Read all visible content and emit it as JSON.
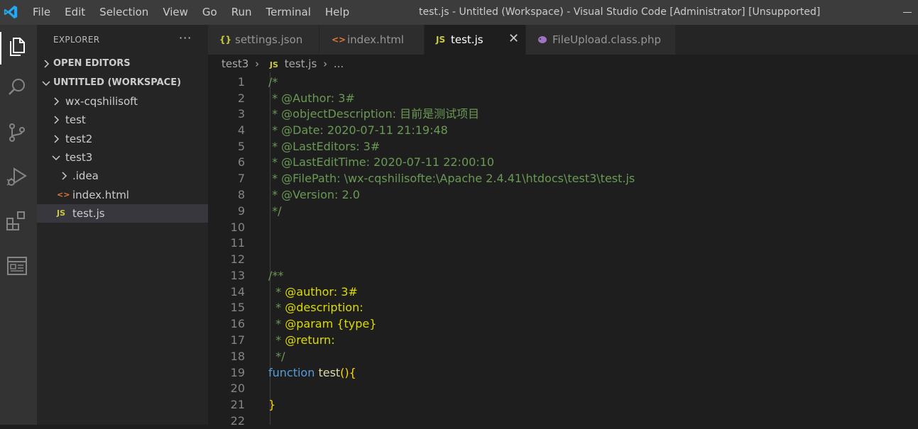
{
  "menu": [
    "File",
    "Edit",
    "Selection",
    "View",
    "Go",
    "Run",
    "Terminal",
    "Help"
  ],
  "window_title": "test.js - Untitled (Workspace) - Visual Studio Code [Administrator] [Unsupported]",
  "activity_icons": [
    "files-icon",
    "search-icon",
    "source-control-icon",
    "run-debug-icon",
    "extensions-icon",
    "remote-explorer-icon"
  ],
  "sidebar": {
    "header": "EXPLORER",
    "more": "···",
    "open_editors": "OPEN EDITORS",
    "workspace": "UNTITLED (WORKSPACE)",
    "tree": [
      {
        "label": "wx-cqshilisoft"
      },
      {
        "label": "test"
      },
      {
        "label": "test2"
      },
      {
        "label": "test3"
      },
      {
        "label": ".idea"
      },
      {
        "label": "index.html",
        "icon": "<>"
      },
      {
        "label": "test.js",
        "icon": "JS"
      }
    ]
  },
  "tabs": [
    {
      "label": "settings.json",
      "icon": "{}"
    },
    {
      "label": "index.html",
      "icon": "<>"
    },
    {
      "label": "test.js",
      "icon": "JS"
    },
    {
      "label": "FileUpload.class.php",
      "icon": "php"
    }
  ],
  "tab_close": "✕",
  "breadcrumb": {
    "folder": "test3",
    "icon": "JS",
    "file": "test.js",
    "tail": "..."
  },
  "line_numbers": [
    "1",
    "2",
    "3",
    "4",
    "5",
    "6",
    "7",
    "8",
    "9",
    "10",
    "11",
    "12",
    "13",
    "14",
    "15",
    "16",
    "17",
    "18",
    "19",
    "20",
    "21",
    "22"
  ],
  "code": {
    "l1": "/*",
    "l2": " * @Author: 3#",
    "l3": " * @objectDescription: 目前是测试项目",
    "l4": " * @Date: 2020-07-11 21:19:48",
    "l5": " * @LastEditors: 3#",
    "l6": " * @LastEditTime: 2020-07-11 22:00:10",
    "l7": " * @FilePath: \\wx-cqshilisofte:\\Apache 2.4.41\\htdocs\\test3\\test.js",
    "l8": " * @Version: 2.0",
    "l9": " */",
    "l13": "/**",
    "l14_star": "  * ",
    "l14_text": "@author: 3#",
    "l15_star": "  * ",
    "l15_text": "@description:",
    "l16_star": "  * ",
    "l16_text": "@param {type}",
    "l17_star": "  * ",
    "l17_text": "@return:",
    "l18": "  */",
    "l19_kw": "function",
    "l19_fn": " test",
    "l19_brace": "(){",
    "l21": "}"
  },
  "colors": {
    "accent": "#007acc",
    "comment": "#6a9955",
    "jsdoc_tag": "#dcdc00",
    "keyword": "#569cd6",
    "js_icon": "#cbcb41",
    "html_icon": "#e37933",
    "json_icon": "#cbcb41",
    "php_icon": "#a074c4"
  }
}
